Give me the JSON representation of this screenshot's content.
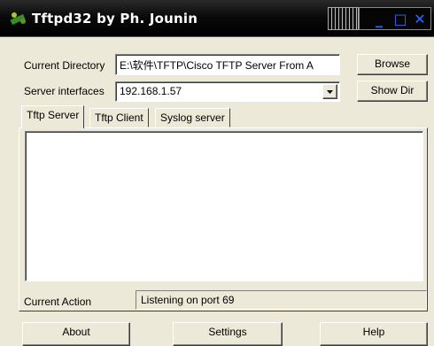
{
  "window": {
    "title": "Tftpd32 by Ph. Jounin",
    "minimize_glyph": "_",
    "maximize_glyph": "□",
    "close_glyph": "✕"
  },
  "current_directory": {
    "label": "Current Directory",
    "value": "E:\\软件\\TFTP\\Cisco TFTP Server From A",
    "browse_label": "Browse"
  },
  "server_interfaces": {
    "label": "Server interfaces",
    "value": "192.168.1.57",
    "show_dir_label": "Show Dir"
  },
  "tabs": [
    {
      "label": "Tftp Server",
      "active": true
    },
    {
      "label": "Tftp Client",
      "active": false
    },
    {
      "label": "Syslog server",
      "active": false
    }
  ],
  "status": {
    "label": "Current Action",
    "value": "Listening on port 69"
  },
  "buttons": {
    "about": "About",
    "settings": "Settings",
    "help": "Help"
  },
  "colors": {
    "titlebar": "#000000",
    "window_bg": "#ece9d8",
    "caption_buttons": "#2a6cff"
  }
}
